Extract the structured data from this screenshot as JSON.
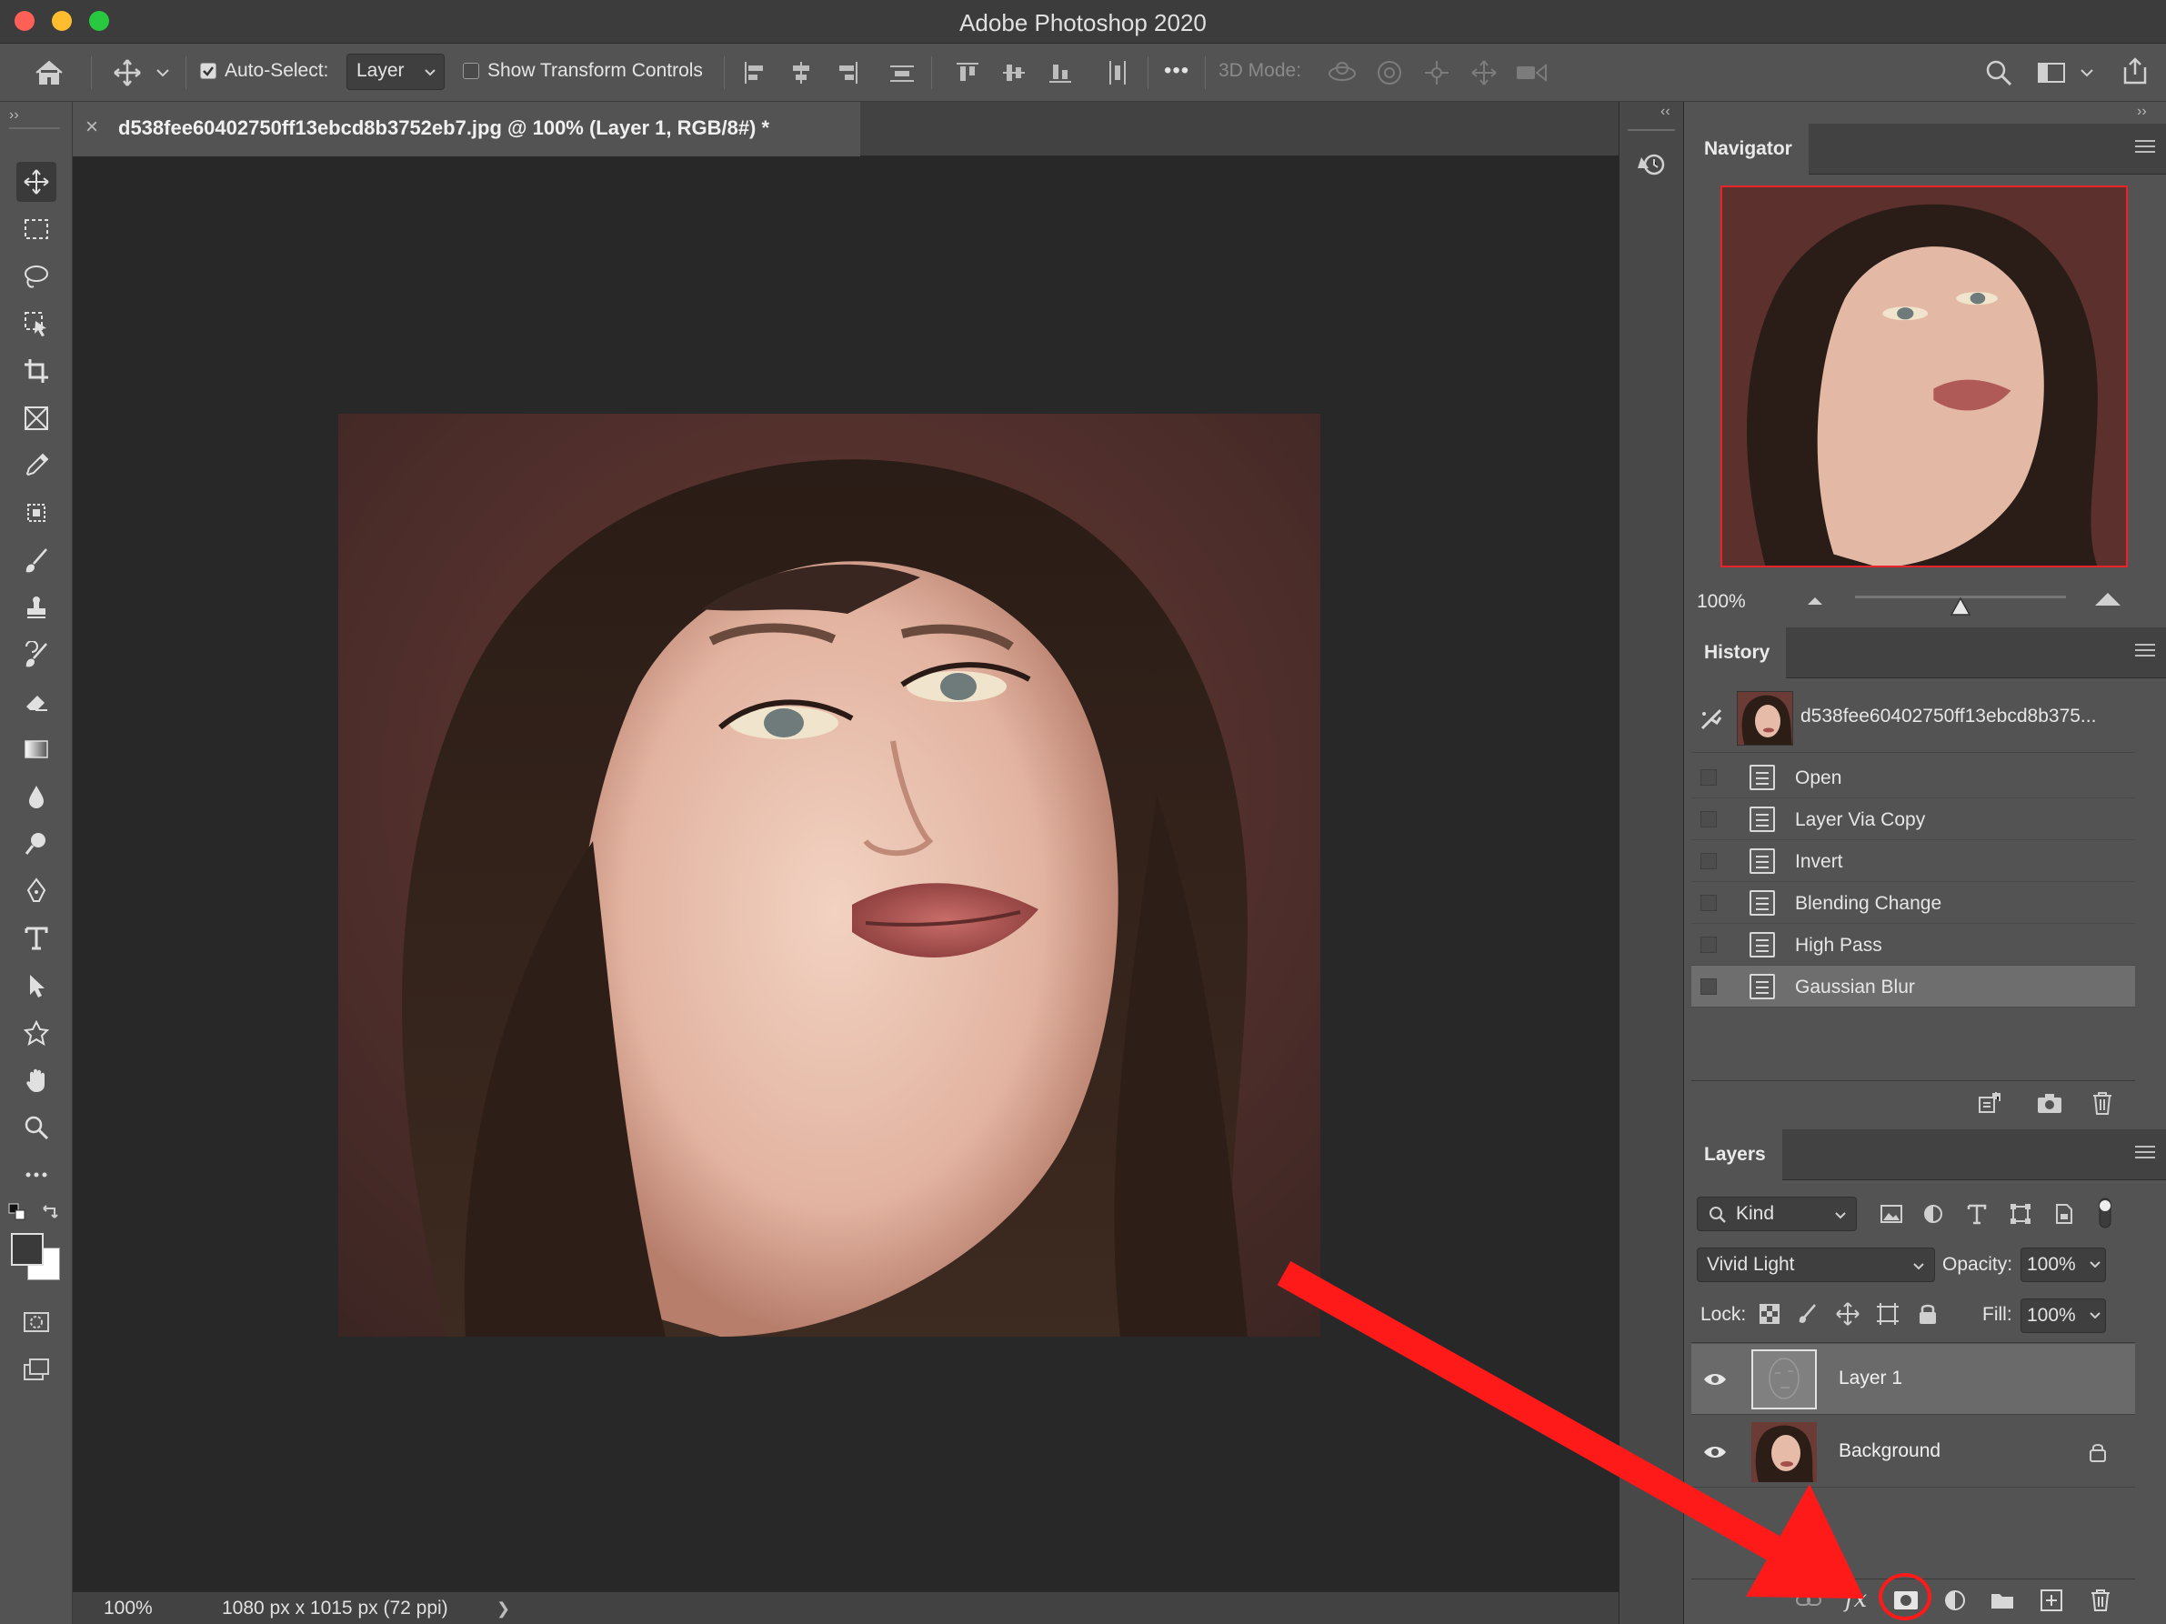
{
  "window": {
    "title": "Adobe Photoshop 2020"
  },
  "options_bar": {
    "auto_select_label": "Auto-Select:",
    "auto_select_checked": true,
    "auto_select_target": "Layer",
    "show_transform_label": "Show Transform Controls",
    "show_transform_checked": false,
    "mode_3d_label": "3D Mode:",
    "more_label": "•••"
  },
  "document": {
    "tab_title": "d538fee60402750ff13ebcd8b3752eb7.jpg @ 100% (Layer 1, RGB/8#) *",
    "close_glyph": "×"
  },
  "status": {
    "zoom": "100%",
    "dimensions": "1080 px x 1015 px (72 ppi)",
    "arrow": "❯"
  },
  "toolbar": {
    "tools": [
      "move",
      "marquee",
      "lasso",
      "object-select",
      "crop",
      "frame",
      "eyedropper",
      "healing",
      "brush",
      "stamp",
      "history-brush",
      "eraser",
      "gradient",
      "blur",
      "dodge",
      "pen",
      "type",
      "path-select",
      "shape",
      "hand",
      "zoom",
      "more"
    ]
  },
  "navigator": {
    "tab": "Navigator",
    "zoom": "100%",
    "zoom_level": 0.5
  },
  "history": {
    "tab": "History",
    "snapshot_name": "d538fee60402750ff13ebcd8b375...",
    "items": [
      "Open",
      "Layer Via Copy",
      "Invert",
      "Blending Change",
      "High Pass",
      "Gaussian Blur"
    ],
    "selected": "Gaussian Blur"
  },
  "layers": {
    "tab": "Layers",
    "filter_kind": "Kind",
    "blend_mode": "Vivid Light",
    "opacity_label": "Opacity:",
    "opacity_value": "100%",
    "lock_label": "Lock:",
    "fill_label": "Fill:",
    "fill_value": "100%",
    "items": [
      {
        "name": "Layer 1",
        "selected": true
      },
      {
        "name": "Background",
        "locked": true
      }
    ]
  },
  "annotation": {
    "color": "#ff1a1a"
  },
  "colors": {
    "accent_red": "#ff1a1a",
    "canvas_bg": "#282828",
    "panel_bg": "#535353"
  }
}
